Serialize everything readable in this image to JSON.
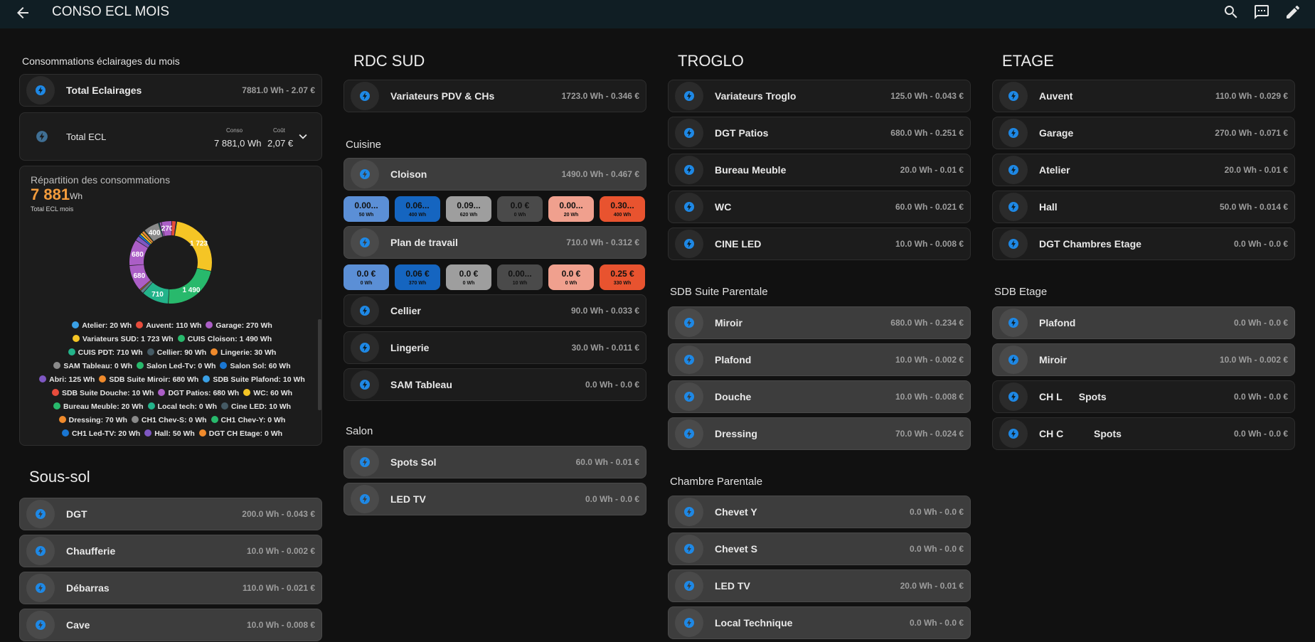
{
  "header": {
    "title": "CONSO ECL MOIS"
  },
  "colors": {
    "accent": "#03a9f4",
    "icon_blue": "#1e88e5"
  },
  "summary": {
    "title": "Consommations éclairages du mois",
    "total_row": {
      "name": "Total Eclairages",
      "value": "7881.0 Wh - 2.07 €"
    },
    "total_ecl": {
      "name": "Total ECL",
      "conso_label": "Conso",
      "conso_value": "7 881,0 Wh",
      "cout_label": "Coût",
      "cout_value": "2,07 €"
    },
    "repartition": {
      "title": "Répartition des consommations",
      "value": "7 881",
      "unit": "Wh",
      "caption": "Total ECL mois"
    },
    "donut": [
      {
        "label": "1 723",
        "value": 1723,
        "color": "#f5c525"
      },
      {
        "label": "1 490",
        "value": 1490,
        "color": "#28b96c"
      },
      {
        "label": "710",
        "value": 710,
        "color": "#23b38a"
      },
      {
        "label": "",
        "value": 90,
        "color": "#607d8b"
      },
      {
        "label": "",
        "value": 30,
        "color": "#ef8a2c"
      },
      {
        "label": "680",
        "value": 680,
        "color": "#ab5ec6"
      },
      {
        "label": "680",
        "value": 680,
        "color": "#ab5ec6"
      },
      {
        "label": "",
        "value": 125,
        "color": "#7e57c2"
      },
      {
        "label": "",
        "value": 60,
        "color": "#1976d2"
      },
      {
        "label": "",
        "value": 60,
        "color": "#f5c525"
      },
      {
        "label": "",
        "value": 70,
        "color": "#e8893a"
      },
      {
        "label": "",
        "value": 20,
        "color": "#28b96c"
      },
      {
        "label": "400",
        "value": 400,
        "color": "#8a8a8a"
      },
      {
        "label": "",
        "value": 10,
        "color": "#23b38a"
      },
      {
        "label": "",
        "value": 20,
        "color": "#1976d2"
      },
      {
        "label": "",
        "value": 50,
        "color": "#ab5ec6"
      },
      {
        "label": "270",
        "value": 270,
        "color": "#ab5ec6"
      },
      {
        "label": "",
        "value": 110,
        "color": "#e74c3c"
      },
      {
        "label": "",
        "value": 20,
        "color": "#03a9f4"
      }
    ],
    "legend": [
      {
        "text": "Atelier: 20 Wh",
        "color": "#3aa0e6"
      },
      {
        "text": "Auvent: 110 Wh",
        "color": "#e74c3c"
      },
      {
        "text": "Garage: 270 Wh",
        "color": "#ab5ec6"
      },
      {
        "text": "Variateurs SUD: 1 723 Wh",
        "color": "#f5c525"
      },
      {
        "text": "CUIS Cloison: 1 490 Wh",
        "color": "#28b96c"
      },
      {
        "text": "CUIS PDT: 710 Wh",
        "color": "#23b38a"
      },
      {
        "text": "Cellier: 90 Wh",
        "color": "#455a64"
      },
      {
        "text": "Lingerie: 30 Wh",
        "color": "#ef8a2c"
      },
      {
        "text": "SAM Tableau: 0 Wh",
        "color": "#8a8a8a"
      },
      {
        "text": "Salon Led-Tv: 0 Wh",
        "color": "#28b96c"
      },
      {
        "text": "Salon Sol: 60 Wh",
        "color": "#1976d2"
      },
      {
        "text": "Abri: 125 Wh",
        "color": "#7e57c2"
      },
      {
        "text": "SDB Suite Miroir: 680 Wh",
        "color": "#ef8a2c"
      },
      {
        "text": "SDB Suite Plafond: 10 Wh",
        "color": "#3aa0e6"
      },
      {
        "text": "SDB Suite Douche: 10 Wh",
        "color": "#e74c3c"
      },
      {
        "text": "DGT Patios: 680 Wh",
        "color": "#ab5ec6"
      },
      {
        "text": "WC: 60 Wh",
        "color": "#f5c525"
      },
      {
        "text": "Bureau Meuble: 20 Wh",
        "color": "#28b96c"
      },
      {
        "text": "Local tech: 0 Wh",
        "color": "#23b38a"
      },
      {
        "text": "Cine LED: 10 Wh",
        "color": "#455a64"
      },
      {
        "text": "Dressing: 70 Wh",
        "color": "#ef8a2c"
      },
      {
        "text": "CH1 Chev-S: 0 Wh",
        "color": "#8a8a8a"
      },
      {
        "text": "CH1 Chev-Y: 0 Wh",
        "color": "#28b96c"
      },
      {
        "text": "CH1 Led-TV: 20 Wh",
        "color": "#1976d2"
      },
      {
        "text": "Hall: 50 Wh",
        "color": "#7e57c2"
      },
      {
        "text": "DGT CH Etage: 0 Wh",
        "color": "#ef8a2c"
      }
    ]
  },
  "sous_sol": {
    "title": "Sous-sol",
    "rows": [
      {
        "name": "DGT",
        "value": "200.0 Wh - 0.043 €"
      },
      {
        "name": "Chaufferie",
        "value": "10.0 Wh - 0.002 €"
      },
      {
        "name": "Débarras",
        "value": "110.0 Wh - 0.021 €"
      },
      {
        "name": "Cave",
        "value": "10.0 Wh - 0.008 €"
      }
    ]
  },
  "rdc_sud": {
    "title": "RDC SUD",
    "variateurs": {
      "name": "Variateurs PDV & CHs",
      "value": "1723.0 Wh - 0.346 €"
    },
    "cuisine_title": "Cuisine",
    "cloison": {
      "name": "Cloison",
      "value": "1490.0 Wh - 0.467 €"
    },
    "cloison_chips": [
      {
        "v": "0.00...",
        "wh": "50 Wh",
        "color": "#5b8fd6"
      },
      {
        "v": "0.06...",
        "wh": "400 Wh",
        "color": "#1565c0"
      },
      {
        "v": "0.09...",
        "wh": "620 Wh",
        "color": "#9e9e9e"
      },
      {
        "v": "0.0 €",
        "wh": "0 Wh",
        "color": "#4a4a4a"
      },
      {
        "v": "0.00...",
        "wh": "20 Wh",
        "color": "#f0a08e"
      },
      {
        "v": "0.30...",
        "wh": "400 Wh",
        "color": "#e8532f"
      }
    ],
    "plan": {
      "name": "Plan de travail",
      "value": "710.0 Wh - 0.312 €"
    },
    "plan_chips": [
      {
        "v": "0.0 €",
        "wh": "0 Wh",
        "color": "#5b8fd6"
      },
      {
        "v": "0.06 €",
        "wh": "370 Wh",
        "color": "#1565c0"
      },
      {
        "v": "0.0 €",
        "wh": "0 Wh",
        "color": "#9e9e9e"
      },
      {
        "v": "0.00...",
        "wh": "10 Wh",
        "color": "#4a4a4a"
      },
      {
        "v": "0.0 €",
        "wh": "0 Wh",
        "color": "#f0a08e"
      },
      {
        "v": "0.25 €",
        "wh": "330 Wh",
        "color": "#e8532f"
      }
    ],
    "others": [
      {
        "name": "Cellier",
        "value": "90.0 Wh - 0.033 €"
      },
      {
        "name": "Lingerie",
        "value": "30.0 Wh - 0.011 €"
      },
      {
        "name": "SAM Tableau",
        "value": "0.0 Wh - 0.0 €"
      }
    ],
    "salon_title": "Salon",
    "salon": [
      {
        "name": "Spots Sol",
        "value": "60.0 Wh - 0.01 €"
      },
      {
        "name": "LED TV",
        "value": "0.0 Wh - 0.0 €"
      }
    ]
  },
  "troglo": {
    "title": "TROGLO",
    "rows": [
      {
        "name": "Variateurs Troglo",
        "value": "125.0 Wh - 0.043 €"
      },
      {
        "name": "DGT Patios",
        "value": "680.0 Wh - 0.251 €"
      },
      {
        "name": "Bureau Meuble",
        "value": "20.0 Wh - 0.01 €"
      },
      {
        "name": "WC",
        "value": "60.0 Wh - 0.021 €"
      },
      {
        "name": "CINE LED",
        "value": "10.0 Wh - 0.008 €"
      }
    ],
    "sdb_title": "SDB Suite Parentale",
    "sdb": [
      {
        "name": "Miroir",
        "value": "680.0 Wh - 0.234 €"
      },
      {
        "name": "Plafond",
        "value": "10.0 Wh - 0.002 €"
      },
      {
        "name": "Douche",
        "value": "10.0 Wh - 0.008 €"
      },
      {
        "name": "Dressing",
        "value": "70.0 Wh - 0.024 €"
      }
    ],
    "chambre_title": "Chambre Parentale",
    "chambre": [
      {
        "name": "Chevet Y",
        "value": "0.0 Wh - 0.0 €"
      },
      {
        "name": "Chevet S",
        "value": "0.0 Wh - 0.0 €"
      },
      {
        "name": "LED TV",
        "value": "20.0 Wh - 0.01 €"
      },
      {
        "name": "Local Technique",
        "value": "0.0 Wh - 0.0 €"
      }
    ]
  },
  "etage": {
    "title": "ETAGE",
    "rows": [
      {
        "name": "Auvent",
        "value": "110.0 Wh - 0.029 €"
      },
      {
        "name": "Garage",
        "value": "270.0 Wh - 0.071 €"
      },
      {
        "name": "Atelier",
        "value": "20.0 Wh - 0.01 €"
      },
      {
        "name": "Hall",
        "value": "50.0 Wh - 0.014 €"
      },
      {
        "name": "DGT Chambres Etage",
        "value": "0.0 Wh - 0.0 €"
      }
    ],
    "sdb_title": "SDB Etage",
    "sdb": [
      {
        "name": "Plafond",
        "value": "0.0 Wh - 0.0 €"
      },
      {
        "name": "Miroir",
        "value": "10.0 Wh - 0.002 €"
      },
      {
        "name": "CH L      Spots",
        "value": "0.0 Wh - 0.0 €"
      },
      {
        "name": "CH C           Spots",
        "value": "0.0 Wh - 0.0 €"
      }
    ]
  }
}
